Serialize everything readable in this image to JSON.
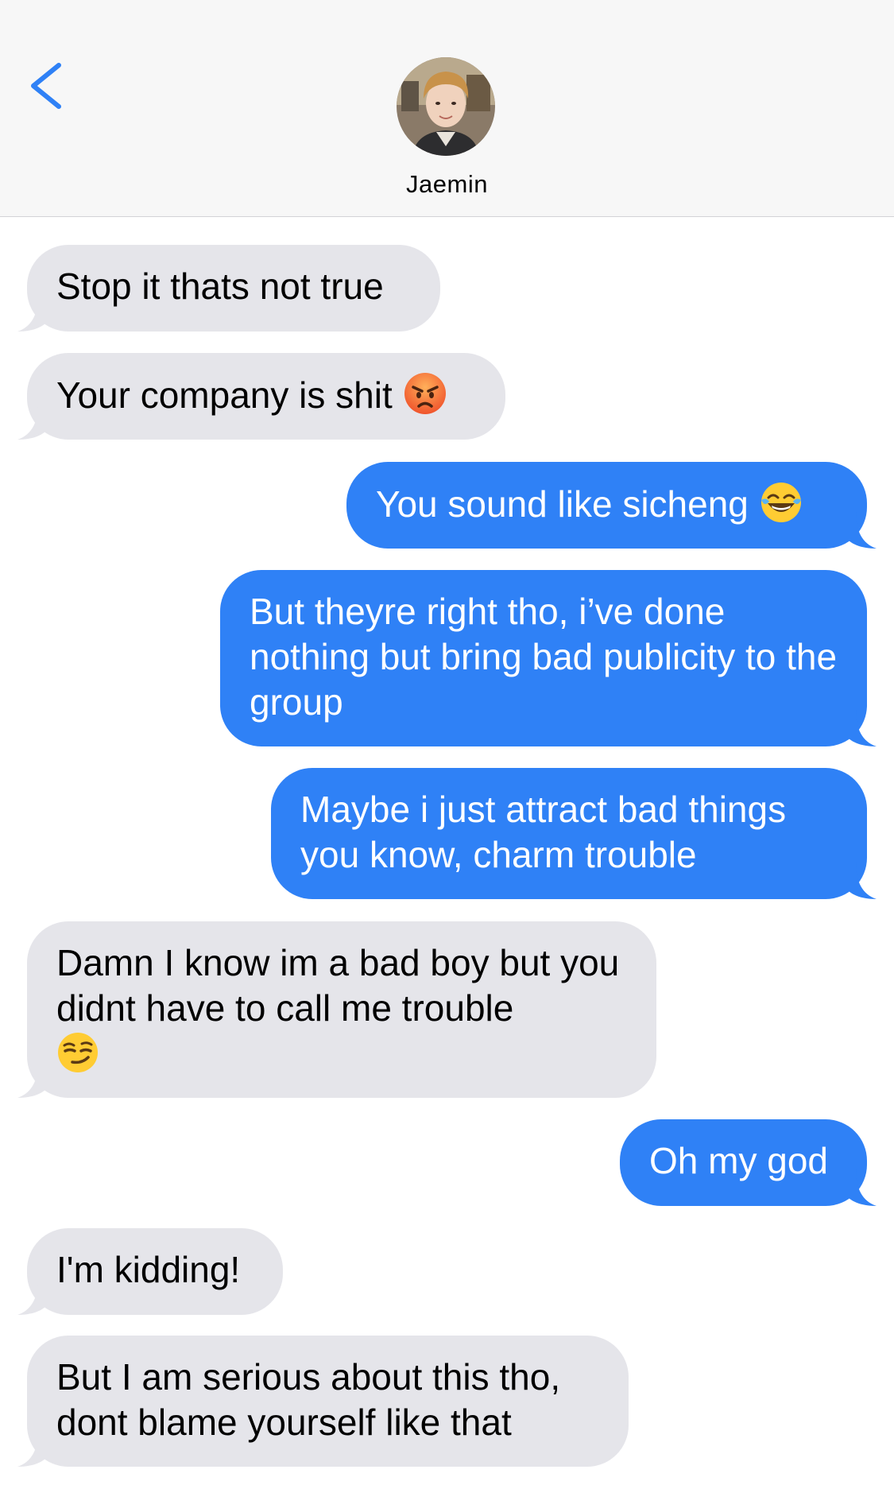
{
  "header": {
    "contact_name": "Jaemin",
    "back_icon": "chevron-left-icon",
    "accent_color": "#2f81f6"
  },
  "messages": [
    {
      "side": "received",
      "text": "Stop it thats not true"
    },
    {
      "side": "received",
      "text": "Your company is shit",
      "emoji": "angry-face"
    },
    {
      "side": "sent",
      "text": "You sound like sicheng",
      "emoji": "tears-of-joy"
    },
    {
      "side": "sent",
      "text": "But theyre right tho, i’ve done nothing but bring bad publicity to the group"
    },
    {
      "side": "sent",
      "text": "Maybe i just attract bad things you know, charm trouble"
    },
    {
      "side": "received",
      "text": "Damn I know im a bad boy but you didnt have to call me trouble",
      "emoji": "smirking-face"
    },
    {
      "side": "sent",
      "text": "Oh my god"
    },
    {
      "side": "received",
      "text": "I'm kidding!"
    },
    {
      "side": "received",
      "text": "But I am serious about this tho, dont blame yourself like that"
    }
  ],
  "colors": {
    "sent_bubble": "#2f81f6",
    "received_bubble": "#e5e5ea",
    "header_bg": "#f7f7f7"
  }
}
